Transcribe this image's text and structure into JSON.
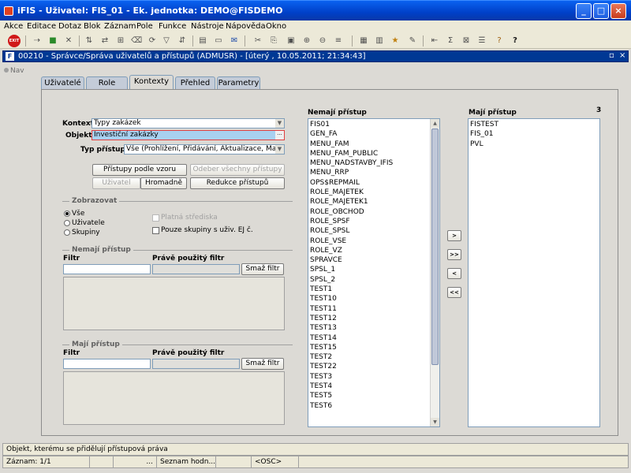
{
  "window": {
    "title": "iFIS - Uživatel: FIS_01 - Ek. jednotka: DEMO@FISDEMO",
    "minimize": "_",
    "maximize": "□",
    "close": "×"
  },
  "menu": [
    "Akce",
    "Editace",
    "Dotaz",
    "Blok",
    "Záznam",
    "Pole",
    "Funkce",
    "Nástroje",
    "Nápověda",
    "Okno"
  ],
  "toolbar": {
    "exit": "EXIT"
  },
  "inner_window": {
    "icon": "F",
    "title": "00210 - Správce/Správa uživatelů a přístupů (ADMUSR) - [úterý , 10.05.2011; 21:34:43]",
    "restore": "▫",
    "close": "×"
  },
  "nav": {
    "label": "Nav"
  },
  "tabs": [
    "Uživatelé",
    "Role",
    "Kontexty",
    "Přehled",
    "Parametry"
  ],
  "active_tab": "Kontexty",
  "form": {
    "kontext_label": "Kontext",
    "kontext_value": "Typy zakázek",
    "objekt_label": "Objekt",
    "objekt_value": "Investiční zakázky",
    "typ_label": "Typ přístupu",
    "typ_value": "Vše (Prohlížení, Přidávání, Aktualizace, Mazání)",
    "ellipsis": "···"
  },
  "buttons": {
    "pristupy_vzor": "Přístupy podle vzoru",
    "odeber_vse": "Odeber všechny přístupy",
    "uzivatel": "Uživatel",
    "hromadne": "Hromadně",
    "redukce": "Redukce přístupů",
    "smaz_filtr_1": "Smaž filtr",
    "smaz_filtr_2": "Smaž filtr",
    "move_right": ">",
    "move_all_right": ">>",
    "move_left": "<",
    "move_all_left": "<<"
  },
  "zobrazovat": {
    "title": "Zobrazovat",
    "options": [
      "Vše",
      "Uživatele",
      "Skupiny"
    ],
    "selected": "Vše",
    "platna_strediska": "Platná střediska",
    "pouze_skupiny": "Pouze skupiny s uživ. EJ č."
  },
  "nemaji_filter": {
    "title": "Nemají přístup",
    "filtr_label": "Filtr",
    "used_label": "Právě použitý filtr"
  },
  "maji_filter": {
    "title": "Mají přístup",
    "filtr_label": "Filtr",
    "used_label": "Právě použitý filtr"
  },
  "nemaji_list": {
    "title": "Nemají přístup",
    "items": [
      "FIS01",
      "GEN_FA",
      "MENU_FAM",
      "MENU_FAM_PUBLIC",
      "MENU_NADSTAVBY_IFIS",
      "MENU_RRP",
      "OPS$REPMAIL",
      "ROLE_MAJETEK",
      "ROLE_MAJETEK1",
      "ROLE_OBCHOD",
      "ROLE_SPSF",
      "ROLE_SPSL",
      "ROLE_VSE",
      "ROLE_VZ",
      "SPRAVCE",
      "SPSL_1",
      "SPSL_2",
      "TEST1",
      "TEST10",
      "TEST11",
      "TEST12",
      "TEST13",
      "TEST14",
      "TEST15",
      "TEST2",
      "TEST22",
      "TEST3",
      "TEST4",
      "TEST5",
      "TEST6"
    ]
  },
  "maji_list": {
    "title": "Mají přístup",
    "count": "3",
    "items": [
      "FISTEST",
      "FIS_01",
      "PVL"
    ]
  },
  "status": {
    "message": "Objekt, kterému se přidělují přístupová práva",
    "zaznam": "Záznam: 1/1",
    "cell2": "",
    "cell3": "...",
    "seznam": "Seznam hodn...",
    "cell5": "",
    "osc": "<OSC>"
  }
}
